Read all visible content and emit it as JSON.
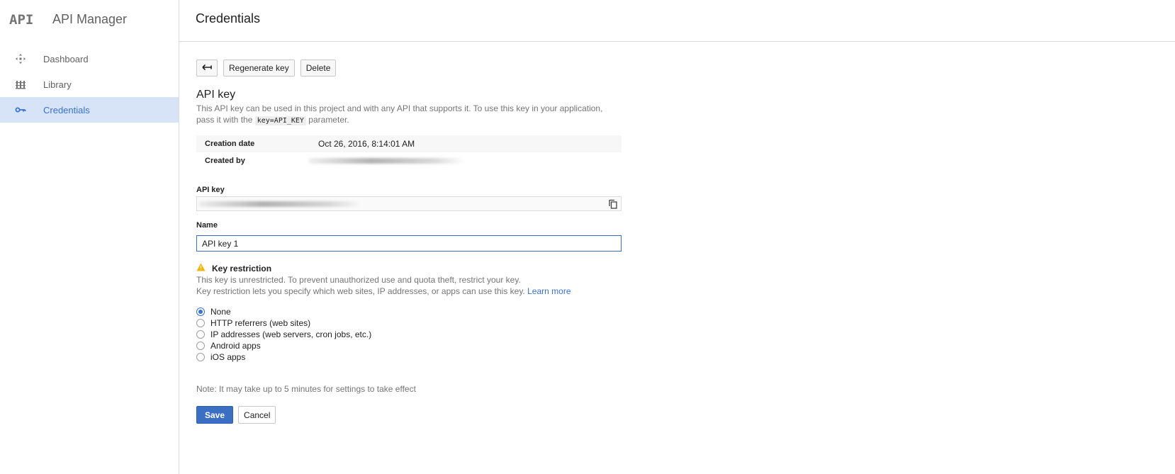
{
  "brand": {
    "logo": "API",
    "title": "API Manager"
  },
  "sidebar": {
    "items": [
      {
        "label": "Dashboard",
        "icon": "dashboard-icon",
        "active": false
      },
      {
        "label": "Library",
        "icon": "library-icon",
        "active": false
      },
      {
        "label": "Credentials",
        "icon": "key-icon",
        "active": true
      }
    ]
  },
  "header": {
    "title": "Credentials"
  },
  "toolbar": {
    "back_icon": "back-arrow-icon",
    "regenerate_label": "Regenerate key",
    "delete_label": "Delete"
  },
  "api_key_section": {
    "title": "API key",
    "desc_part1": "This API key can be used in this project and with any API that supports it. To use this key in your application, pass it with the",
    "desc_code": "key=API_KEY",
    "desc_part2": "parameter."
  },
  "meta": {
    "creation_date_label": "Creation date",
    "creation_date_value": "Oct 26, 2016, 8:14:01 AM",
    "created_by_label": "Created by"
  },
  "fields": {
    "api_key_label": "API key",
    "name_label": "Name",
    "name_value": "API key 1"
  },
  "restriction": {
    "title": "Key restriction",
    "line1": "This key is unrestricted. To prevent unauthorized use and quota theft, restrict your key.",
    "line2": "Key restriction lets you specify which web sites, IP addresses, or apps can use this key.",
    "learn_more": "Learn more",
    "options": [
      {
        "label": "None",
        "checked": true
      },
      {
        "label": "HTTP referrers (web sites)",
        "checked": false
      },
      {
        "label": "IP addresses (web servers, cron jobs, etc.)",
        "checked": false
      },
      {
        "label": "Android apps",
        "checked": false
      },
      {
        "label": "iOS apps",
        "checked": false
      }
    ]
  },
  "note": "Note: It may take up to 5 minutes for settings to take effect",
  "actions": {
    "save_label": "Save",
    "cancel_label": "Cancel"
  },
  "colors": {
    "accent": "#3b6fc3",
    "active_bg": "#d7e4f8",
    "warning": "#f4b400"
  }
}
